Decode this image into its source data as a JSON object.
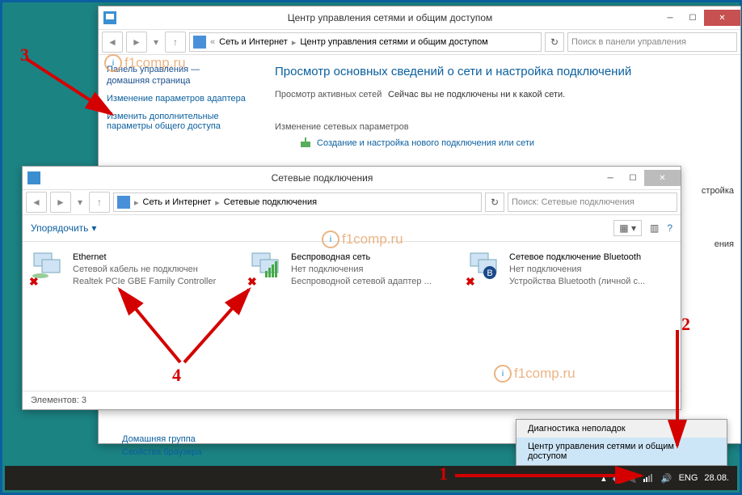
{
  "win1": {
    "title": "Центр управления сетями и общим доступом",
    "bc1": "Сеть и Интернет",
    "bc2": "Центр управления сетями и общим доступом",
    "search": "Поиск в панели управления",
    "sidebar": {
      "hdr1": "Панель управления —",
      "hdr2": "домашняя страница",
      "l1": "Изменение параметров адаптера",
      "l2": "Изменить дополнительные параметры общего доступа"
    },
    "h1": "Просмотр основных сведений о сети и настройка подключений",
    "s1": "Просмотр активных сетей",
    "info1": "Сейчас вы не подключены ни к какой сети.",
    "s2": "Изменение сетевых параметров",
    "task1": "Создание и настройка нового подключения или сети",
    "trail1": "стройка",
    "trail2": "ения"
  },
  "win2": {
    "title": "Сетевые подключения",
    "bc1": "Сеть и Интернет",
    "bc2": "Сетевые подключения",
    "search": "Поиск: Сетевые подключения",
    "organize": "Упорядочить",
    "conn": [
      {
        "n": "Ethernet",
        "s1": "Сетевой кабель не подключен",
        "s2": "Realtek PCIe GBE Family Controller"
      },
      {
        "n": "Беспроводная сеть",
        "s1": "Нет подключения",
        "s2": "Беспроводной сетевой адаптер ..."
      },
      {
        "n": "Сетевое подключение Bluetooth",
        "s1": "Нет подключения",
        "s2": "Устройства Bluetooth (личной с..."
      }
    ],
    "status": "Элементов: 3"
  },
  "flyout": {
    "i1": "Диагностика неполадок",
    "i2": "Центр управления сетями и общим доступом"
  },
  "footer": {
    "l1": "Домашняя группа",
    "l2": "Свойства браузера"
  },
  "tray": {
    "lang": "ENG",
    "date": "28.08."
  },
  "wm": "f1comp.ru",
  "anno": {
    "n1": "1",
    "n2": "2",
    "n3": "3",
    "n4": "4"
  }
}
